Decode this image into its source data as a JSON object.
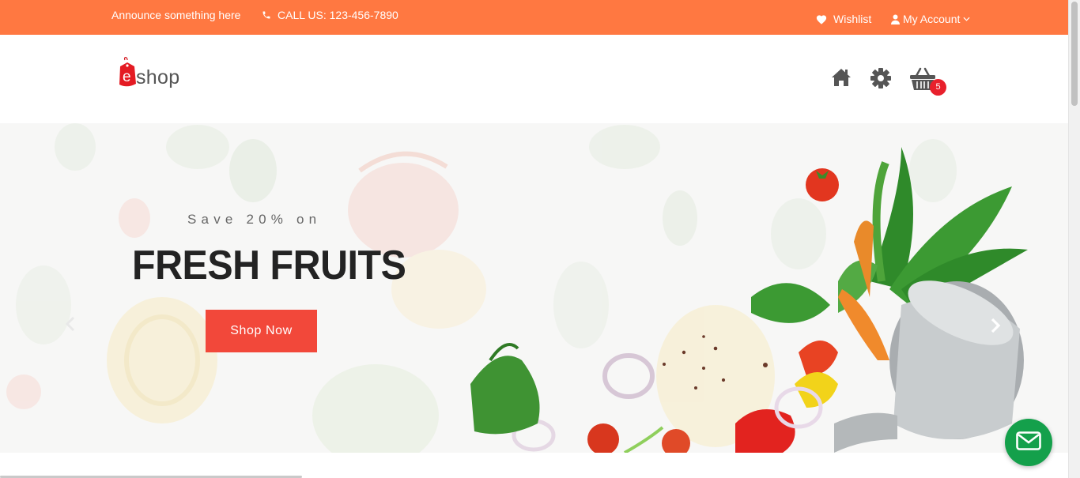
{
  "topbar": {
    "announcement": "Announce something here",
    "call": "CALL US: 123-456-7890",
    "wishlist": "Wishlist",
    "account": "My Account"
  },
  "header": {
    "logo_text": "shop",
    "logo_tag_letter": "e",
    "icons": [
      "home-icon",
      "gear-icon",
      "cart-icon"
    ],
    "cart_count": "5"
  },
  "hero": {
    "subtitle": "Save 20% on",
    "title": "FRESH FRUITS",
    "button": "Shop Now"
  },
  "colors": {
    "topbar": "#ff7841",
    "button": "#f2483a",
    "badge": "#e8202c",
    "mail_fab": "#14a04b"
  }
}
